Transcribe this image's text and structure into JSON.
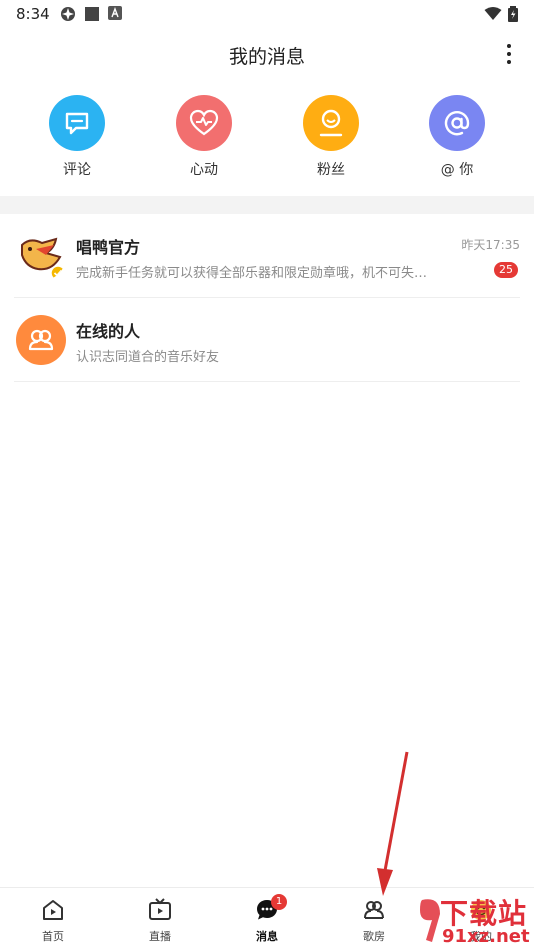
{
  "status_bar": {
    "time": "8:34"
  },
  "header": {
    "title": "我的消息"
  },
  "quick_actions": [
    {
      "label": "评论",
      "icon": "comment-icon",
      "color": "#2bb3f2"
    },
    {
      "label": "心动",
      "icon": "heart-pulse-icon",
      "color": "#f26f6f"
    },
    {
      "label": "粉丝",
      "icon": "fan-icon",
      "color": "#ffad12"
    },
    {
      "label": "@ 你",
      "icon": "at-icon",
      "color": "#7a86f2"
    }
  ],
  "messages": [
    {
      "title": "唱鸭官方",
      "subtitle": "完成新手任务就可以获得全部乐器和限定勋章哦，机不可失…",
      "time": "昨天17:35",
      "badge": "25",
      "avatar": "duck-logo"
    },
    {
      "title": "在线的人",
      "subtitle": "认识志同道合的音乐好友",
      "avatar": "people-icon",
      "color": "#ff8a3d"
    }
  ],
  "bottom_nav": [
    {
      "label": "首页",
      "icon": "home-play-icon"
    },
    {
      "label": "直播",
      "icon": "live-tv-icon"
    },
    {
      "label": "消息",
      "icon": "chat-icon",
      "badge": "1",
      "active": true
    },
    {
      "label": "歌房",
      "icon": "room-icon"
    },
    {
      "label": "我的",
      "icon": "profile-icon"
    }
  ],
  "watermark": {
    "brand": "下载站",
    "domain": "91xz.net"
  }
}
